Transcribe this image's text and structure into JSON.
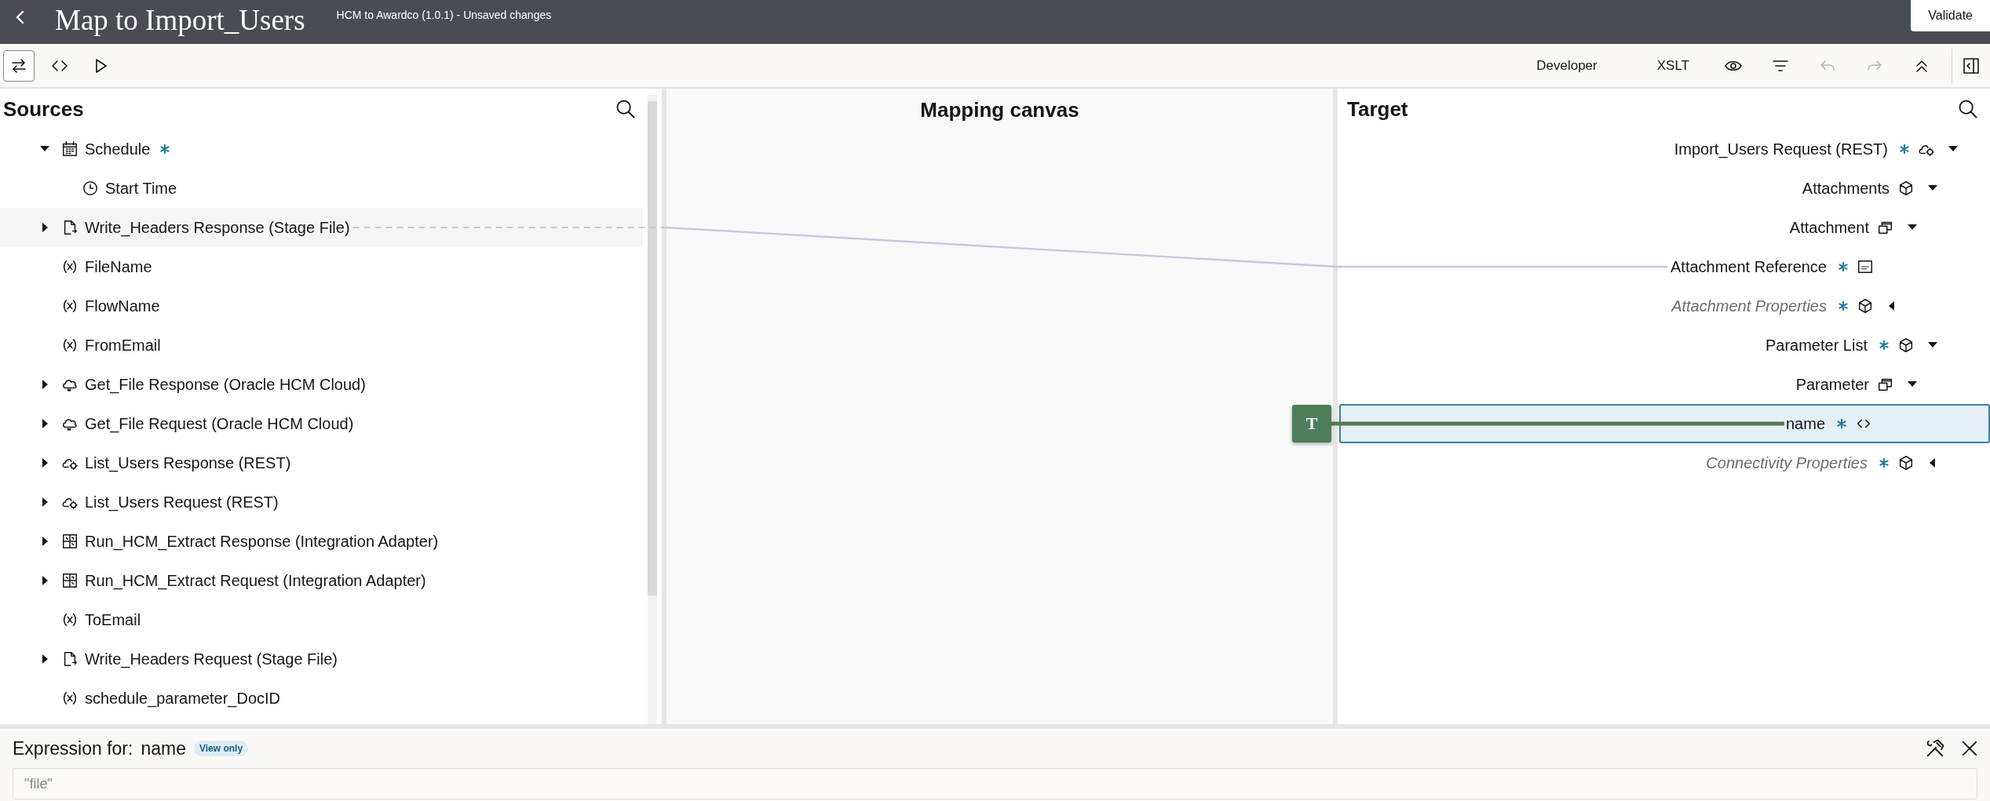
{
  "header": {
    "title": "Map to Import_Users",
    "subtitle": "HCM to Awardco (1.0.1) - Unsaved changes",
    "validate_button": "Validate"
  },
  "toolbar": {
    "modes": [
      {
        "kind": "map",
        "selected": true
      },
      {
        "kind": "code",
        "selected": false
      },
      {
        "kind": "test",
        "selected": false
      }
    ],
    "views": [
      {
        "label": "Developer"
      },
      {
        "label": "XSLT"
      }
    ],
    "actions": [
      {
        "kind": "eye",
        "disabled": false
      },
      {
        "kind": "filter",
        "disabled": false
      },
      {
        "kind": "undo",
        "disabled": true
      },
      {
        "kind": "redo",
        "disabled": true
      },
      {
        "kind": "collapse",
        "disabled": false
      }
    ]
  },
  "sources": {
    "title": "Sources",
    "items": [
      {
        "label": "Schedule",
        "kind": "schedule",
        "required": true,
        "expanded": true,
        "children": [
          {
            "label": "Start Time",
            "kind": "time"
          }
        ]
      },
      {
        "label": "Write_Headers Response (Stage File)",
        "kind": "file",
        "expanded": false,
        "mapped": true
      },
      {
        "label": "FileName",
        "kind": "variable"
      },
      {
        "label": "FlowName",
        "kind": "variable"
      },
      {
        "label": "FromEmail",
        "kind": "variable"
      },
      {
        "label": "Get_File Response (Oracle HCM Cloud)",
        "kind": "cloud",
        "expanded": false
      },
      {
        "label": "Get_File Request (Oracle HCM Cloud)",
        "kind": "cloud",
        "expanded": false
      },
      {
        "label": "List_Users Response (REST)",
        "kind": "rest",
        "expanded": false
      },
      {
        "label": "List_Users Request (REST)",
        "kind": "rest",
        "expanded": false
      },
      {
        "label": "Run_HCM_Extract Response (Integration Adapter)",
        "kind": "adapter",
        "expanded": false
      },
      {
        "label": "Run_HCM_Extract Request (Integration Adapter)",
        "kind": "adapter",
        "expanded": false
      },
      {
        "label": "ToEmail",
        "kind": "variable"
      },
      {
        "label": "Write_Headers Request (Stage File)",
        "kind": "file",
        "expanded": false
      },
      {
        "label": "schedule_parameter_DocID",
        "kind": "variable"
      }
    ]
  },
  "canvas": {
    "title": "Mapping canvas",
    "function_node": {
      "label": "T"
    }
  },
  "target": {
    "title": "Target",
    "items": [
      {
        "label": "Import_Users Request (REST)",
        "kind": "rest",
        "required": true,
        "expanded": true,
        "children": [
          {
            "label": "Attachments",
            "kind": "object",
            "required": false,
            "expanded": true,
            "children": [
              {
                "label": "Attachment",
                "kind": "array",
                "required": false,
                "expanded": true,
                "children": [
                  {
                    "label": "Attachment Reference",
                    "kind": "string",
                    "required": true,
                    "mapped": true
                  },
                  {
                    "label": "Attachment Properties",
                    "kind": "object",
                    "required": true,
                    "expanded": false,
                    "optional": true
                  }
                ]
              }
            ]
          },
          {
            "label": "Parameter List",
            "kind": "object",
            "required": true,
            "expanded": true,
            "children": [
              {
                "label": "Parameter",
                "kind": "array",
                "required": false,
                "expanded": true,
                "children": [
                  {
                    "label": "name",
                    "kind": "element",
                    "required": true,
                    "selected": true
                  }
                ]
              }
            ]
          },
          {
            "label": "Connectivity Properties",
            "kind": "object",
            "required": true,
            "expanded": false,
            "optional": true
          }
        ]
      }
    ]
  },
  "expression": {
    "label": "Expression for:",
    "field_name": "name",
    "badge": "View only",
    "value": "\"file\""
  }
}
